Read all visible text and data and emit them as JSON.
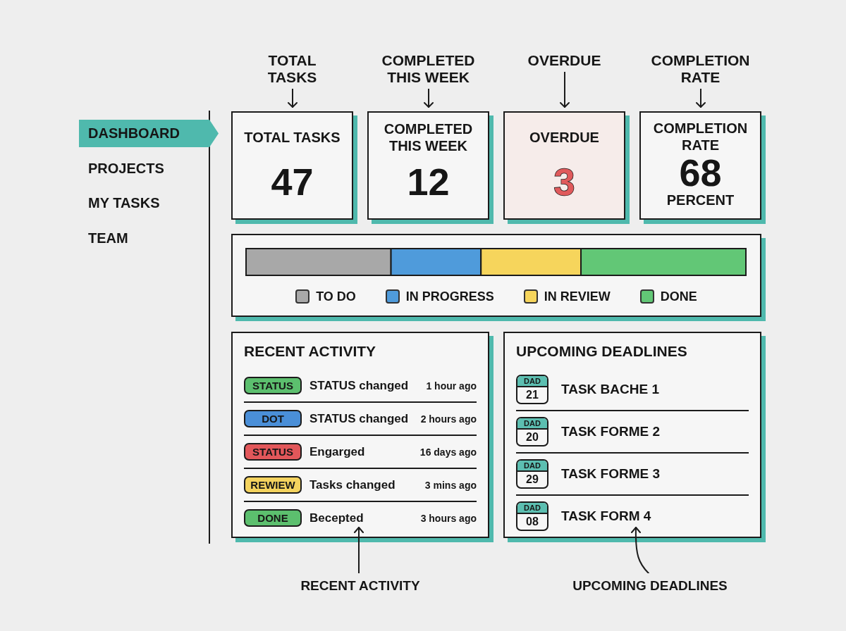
{
  "callouts_top": [
    "TOTAL\nTASKS",
    "COMPLETED\nTHIS WEEK",
    "OVERDUE",
    "COMPLETION\nRATE"
  ],
  "sidebar": {
    "items": [
      {
        "label": "DASHBOARD",
        "selected": true
      },
      {
        "label": "PROJECTS",
        "selected": false
      },
      {
        "label": "MY TASKS",
        "selected": false
      },
      {
        "label": "TEAM",
        "selected": false
      }
    ]
  },
  "stat_cards": [
    {
      "title": "TOTAL TASKS",
      "value": "47",
      "alert": false
    },
    {
      "title": "COMPLETED\nTHIS WEEK",
      "value": "12",
      "alert": false
    },
    {
      "title": "OVERDUE",
      "value": "3",
      "alert": true
    },
    {
      "title": "COMPLETION\nRATE",
      "value": "68",
      "caption": "PERCENT",
      "alert": false
    }
  ],
  "status_breakdown": {
    "legend": [
      {
        "label": "TO DO",
        "color": "#a8a8a8"
      },
      {
        "label": "IN PROGRESS",
        "color": "#4f9bdb"
      },
      {
        "label": "IN REVIEW",
        "color": "#f6d55c"
      },
      {
        "label": "DONE",
        "color": "#62c776"
      }
    ]
  },
  "recent_activity": {
    "title": "RECENT ACTIVITY",
    "items": [
      {
        "badge": "STATUS",
        "color": "#5cbf6e",
        "text": "STATUS changed",
        "time": "1 hour ago"
      },
      {
        "badge": "DOT",
        "color": "#4a8fd8",
        "text": "STATUS changed",
        "time": "2 hours ago"
      },
      {
        "badge": "STATUS",
        "color": "#e2575a",
        "text": "Engarged",
        "time": "16 days ago"
      },
      {
        "badge": "REWIEW",
        "color": "#f4d35e",
        "text": "Tasks changed",
        "time": "3 mins ago"
      },
      {
        "badge": "DONE",
        "color": "#5cbf6e",
        "text": "Becepted",
        "time": "3 hours ago"
      }
    ]
  },
  "upcoming_deadlines": {
    "title": "UPCOMING DEADLINES",
    "items": [
      {
        "month": "DAD",
        "day": "21",
        "task": "TASK BACHE 1"
      },
      {
        "month": "DAD",
        "day": "20",
        "task": "TASK FORME 2"
      },
      {
        "month": "DAD",
        "day": "29",
        "task": "TASK FORME 3"
      },
      {
        "month": "DAD",
        "day": "08",
        "task": "TASK FORM 4"
      }
    ]
  },
  "callouts_bottom": [
    {
      "label": "RECENT ACTIVITY",
      "kind": "straight"
    },
    {
      "label": "UPCOMING DEADLINES",
      "kind": "curved"
    }
  ]
}
